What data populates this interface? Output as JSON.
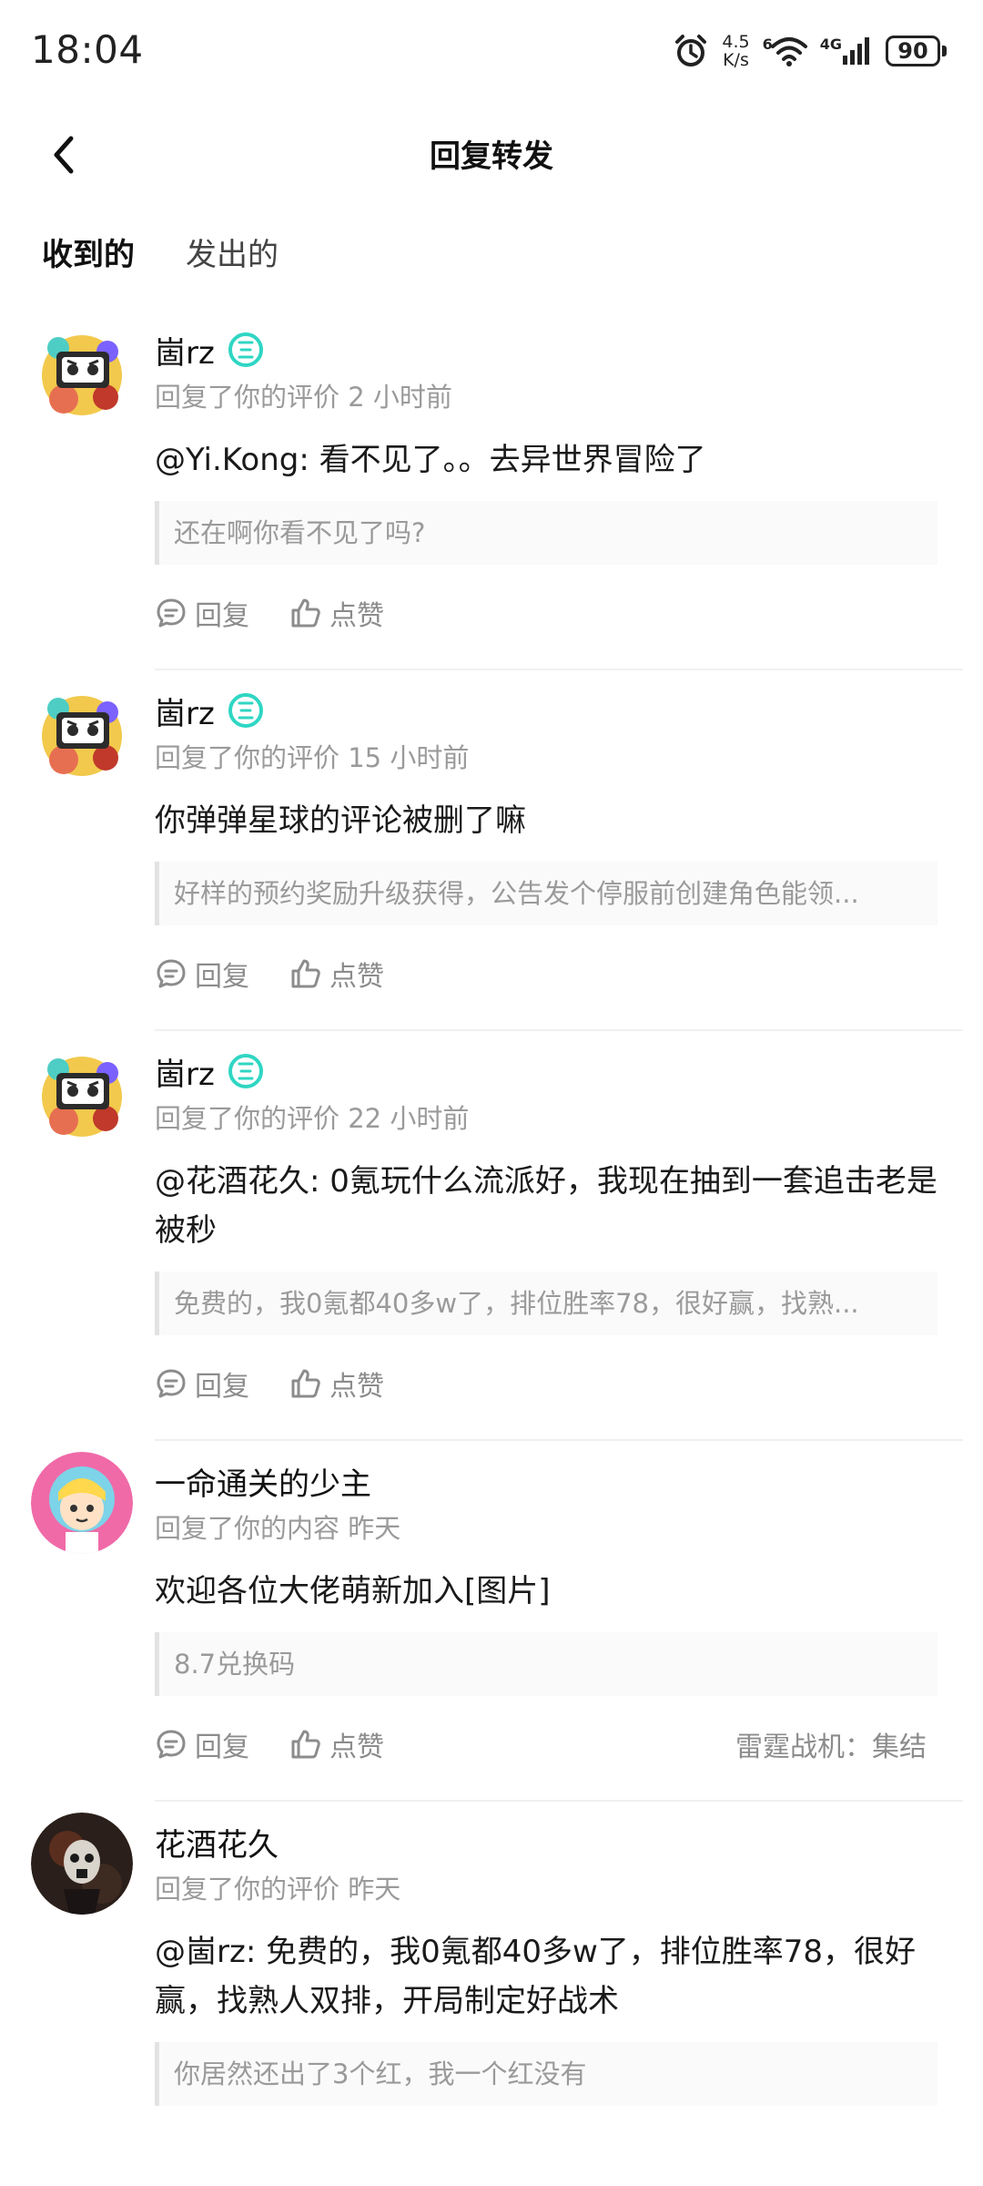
{
  "status_bar": {
    "time": "18:04",
    "net_speed_value": "4.5",
    "net_speed_unit": "K/s",
    "wifi_label": "6",
    "cell_label": "4G",
    "battery": "90"
  },
  "header": {
    "title": "回复转发"
  },
  "tabs": [
    {
      "label": "收到的",
      "active": true
    },
    {
      "label": "发出的",
      "active": false
    }
  ],
  "actions": {
    "reply": "回复",
    "like": "点赞"
  },
  "items": [
    {
      "user": "崮rz",
      "meta": "回复了你的评价 2 小时前",
      "text": "@Yi.Kong: 看不见了。。去异世界冒险了",
      "quote": "还在啊你看不见了吗?"
    },
    {
      "user": "崮rz",
      "meta": "回复了你的评价 15 小时前",
      "text": "你弹弹星球的评论被删了嘛",
      "quote": "好样的预约奖励升级获得，公告发个停服前创建角色能领..."
    },
    {
      "user": "崮rz",
      "meta": "回复了你的评价 22 小时前",
      "text": "@花酒花久: 0氪玩什么流派好，我现在抽到一套追击老是被秒",
      "quote": "免费的，我0氪都40多w了，排位胜率78，很好赢，找熟..."
    },
    {
      "user": "一命通关的少主",
      "meta": "回复了你的内容 昨天",
      "text": "欢迎各位大佬萌新加入[图片]",
      "quote": "8.7兑换码",
      "game": "雷霆战机：集结"
    },
    {
      "user": "花酒花久",
      "meta": "回复了你的评价 昨天",
      "text": "@崮rz: 免费的，我0氪都40多w了，排位胜率78，很好赢，找熟人双排，开局制定好战术",
      "quote": "你居然还出了3个红，我一个红没有"
    }
  ]
}
